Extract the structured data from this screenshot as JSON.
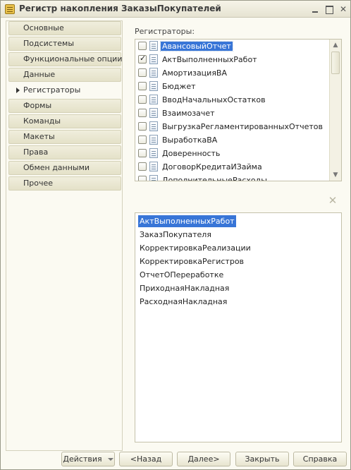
{
  "window": {
    "title": "Регистр накопления ЗаказыПокупателей"
  },
  "nav": {
    "items": [
      {
        "label": "Основные",
        "active": false
      },
      {
        "label": "Подсистемы",
        "active": false
      },
      {
        "label": "Функциональные опции",
        "active": false
      },
      {
        "label": "Данные",
        "active": false
      },
      {
        "label": "Регистраторы",
        "active": true
      },
      {
        "label": "Формы",
        "active": false
      },
      {
        "label": "Команды",
        "active": false
      },
      {
        "label": "Макеты",
        "active": false
      },
      {
        "label": "Права",
        "active": false
      },
      {
        "label": "Обмен данными",
        "active": false
      },
      {
        "label": "Прочее",
        "active": false
      }
    ]
  },
  "registrators": {
    "label": "Регистраторы:",
    "rows": [
      {
        "name": "АвансовыйОтчет",
        "checked": false,
        "selected": true
      },
      {
        "name": "АктВыполненныхРабот",
        "checked": true,
        "selected": false
      },
      {
        "name": "АмортизацияВА",
        "checked": false,
        "selected": false
      },
      {
        "name": "Бюджет",
        "checked": false,
        "selected": false
      },
      {
        "name": "ВводНачальныхОстатков",
        "checked": false,
        "selected": false
      },
      {
        "name": "Взаимозачет",
        "checked": false,
        "selected": false
      },
      {
        "name": "ВыгрузкаРегламентированныхОтчетов",
        "checked": false,
        "selected": false
      },
      {
        "name": "ВыработкаВА",
        "checked": false,
        "selected": false
      },
      {
        "name": "Доверенность",
        "checked": false,
        "selected": false
      },
      {
        "name": "ДоговорКредитаИЗайма",
        "checked": false,
        "selected": false
      },
      {
        "name": "ДополнительныеРасходы",
        "checked": false,
        "selected": false
      }
    ]
  },
  "selected_list": {
    "items": [
      {
        "name": "АктВыполненныхРабот",
        "selected": true
      },
      {
        "name": "ЗаказПокупателя",
        "selected": false
      },
      {
        "name": "КорректировкаРеализации",
        "selected": false
      },
      {
        "name": "КорректировкаРегистров",
        "selected": false
      },
      {
        "name": "ОтчетОПереработке",
        "selected": false
      },
      {
        "name": "ПриходнаяНакладная",
        "selected": false
      },
      {
        "name": "РасходнаяНакладная",
        "selected": false
      }
    ]
  },
  "buttons": {
    "actions": "Действия",
    "back": "<Назад",
    "next": "Далее>",
    "close": "Закрыть",
    "help": "Справка"
  },
  "icons": {
    "window": "register-app-icon",
    "row": "document-icon",
    "clear": "close-icon"
  },
  "colors": {
    "selection": "#3875d7",
    "background": "#fbfaf2"
  }
}
